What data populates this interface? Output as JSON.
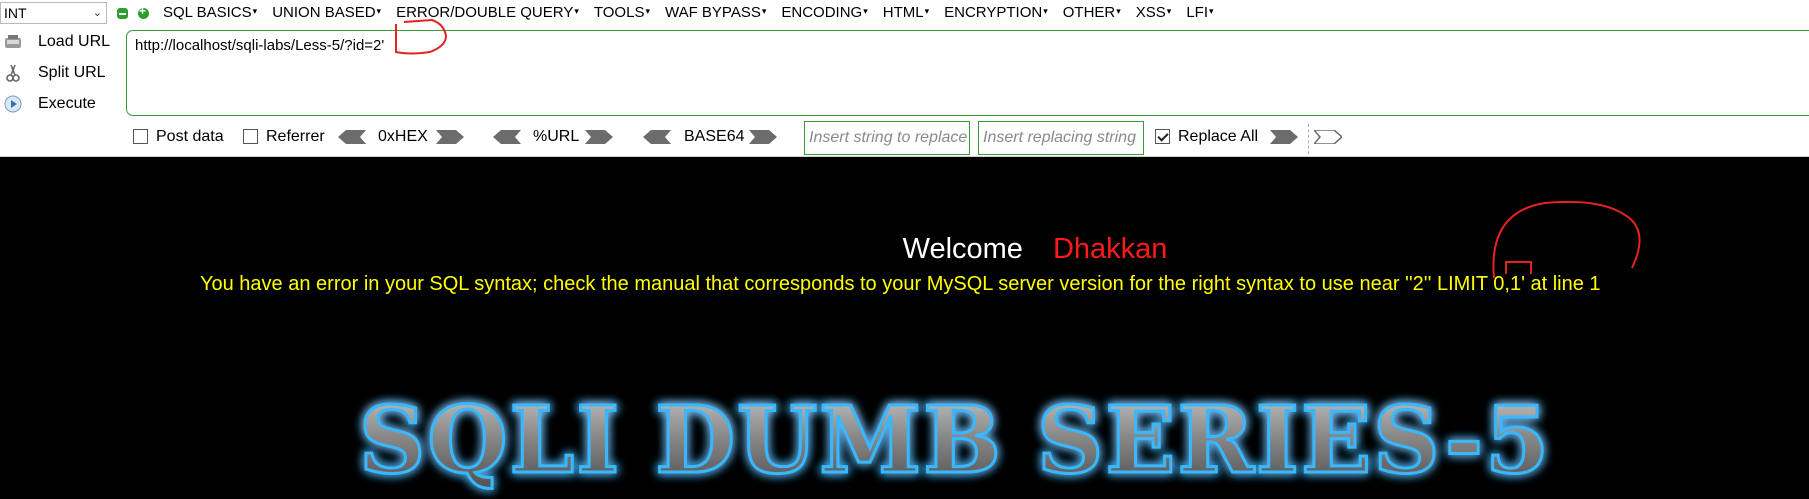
{
  "toolbar": {
    "type_select": "INT",
    "menus": [
      "SQL BASICS",
      "UNION BASED",
      "ERROR/DOUBLE QUERY",
      "TOOLS",
      "WAF BYPASS",
      "ENCODING",
      "HTML",
      "ENCRYPTION",
      "OTHER",
      "XSS",
      "LFI"
    ],
    "actions": {
      "load": "Load URL",
      "split": "Split URL",
      "execute": "Execute"
    },
    "url": "http://localhost/sqli-labs/Less-5/?id=2'",
    "post_data": "Post data",
    "referrer": "Referrer",
    "hex": "0xHEX",
    "url_enc": "%URL",
    "base64": "BASE64",
    "replace_placeholder": "Insert string to replace",
    "replacing_placeholder": "Insert replacing string",
    "replace_all": "Replace All"
  },
  "page": {
    "welcome": "Welcome",
    "user": "Dhakkan",
    "error": "You have an error in your SQL syntax; check the manual that corresponds to your MySQL server version for the right syntax to use near ''2'' LIMIT 0,1' at line 1",
    "banner": "SQLI DUMB SERIES-5"
  },
  "colors": {
    "accent_green": "#3c9a3c",
    "user_red": "#ff1a1a",
    "error_yellow": "#ffff00",
    "annotation_red": "#e52222"
  }
}
